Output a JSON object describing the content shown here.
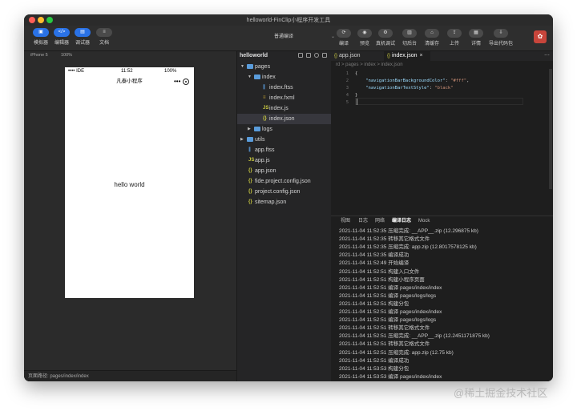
{
  "window": {
    "title": "helloworld-FinClip小程序开发工具"
  },
  "toolbar": {
    "left_buttons": [
      {
        "icon": "phone-icon",
        "label": "模拟器",
        "glyph": "▣",
        "active": true
      },
      {
        "icon": "code-icon",
        "label": "编辑器",
        "glyph": "</>",
        "active": true
      },
      {
        "icon": "debug-icon",
        "label": "调试器",
        "glyph": "▤",
        "active": true
      },
      {
        "icon": "doc-icon",
        "label": "文档",
        "glyph": "≡",
        "active": false
      }
    ],
    "compile_mode": "普通编译",
    "right_buttons": [
      {
        "icon": "compile-icon",
        "label": "编译",
        "glyph": "⟳"
      },
      {
        "icon": "preview-icon",
        "label": "预览",
        "glyph": "◉"
      },
      {
        "icon": "remote-debug-icon",
        "label": "真机调试",
        "glyph": "⚙"
      },
      {
        "icon": "background-icon",
        "label": "切后台",
        "glyph": "▥"
      },
      {
        "icon": "clear-cache-icon",
        "label": "清缓存",
        "glyph": "⌂"
      },
      {
        "icon": "upload-icon",
        "label": "上传",
        "glyph": "⇪"
      },
      {
        "icon": "details-icon",
        "label": "详情",
        "glyph": "▦"
      },
      {
        "icon": "export-icon",
        "label": "导出代码包",
        "glyph": "⇩"
      }
    ],
    "avatar_glyph": "✿"
  },
  "simulator": {
    "device": "iPhone 5",
    "zoom": "100%",
    "status_carrier": "•••• IDE",
    "status_time": "11:52",
    "status_battery": "100%",
    "nav_title": "凡泰小程序",
    "content_text": "hello world",
    "footer_path": "页面路径: pages/index/index"
  },
  "explorer": {
    "title": "helloworld",
    "items": [
      {
        "name": "pages",
        "type": "folder",
        "depth": 0,
        "expanded": true
      },
      {
        "name": "index",
        "type": "folder",
        "depth": 1,
        "expanded": true
      },
      {
        "name": "index.ftss",
        "type": "file",
        "depth": 2,
        "ic": "∥",
        "color": "#5a9cdb"
      },
      {
        "name": "index.fxml",
        "type": "file",
        "depth": 2,
        "ic": "≡",
        "color": "#c5a332"
      },
      {
        "name": "index.js",
        "type": "file",
        "depth": 2,
        "ic": "JS",
        "color": "#cbcb41"
      },
      {
        "name": "index.json",
        "type": "file",
        "depth": 2,
        "ic": "{}",
        "color": "#cbcb41",
        "active": true
      },
      {
        "name": "logs",
        "type": "folder",
        "depth": 1,
        "expanded": false
      },
      {
        "name": "utils",
        "type": "folder",
        "depth": 0,
        "expanded": false
      },
      {
        "name": "app.ftss",
        "type": "file",
        "depth": 0,
        "ic": "∥",
        "color": "#5a9cdb"
      },
      {
        "name": "app.js",
        "type": "file",
        "depth": 0,
        "ic": "JS",
        "color": "#cbcb41"
      },
      {
        "name": "app.json",
        "type": "file",
        "depth": 0,
        "ic": "{}",
        "color": "#cbcb41"
      },
      {
        "name": "fide.project.config.json",
        "type": "file",
        "depth": 0,
        "ic": "{}",
        "color": "#cbcb41"
      },
      {
        "name": "project.config.json",
        "type": "file",
        "depth": 0,
        "ic": "{}",
        "color": "#cbcb41"
      },
      {
        "name": "sitemap.json",
        "type": "file",
        "depth": 0,
        "ic": "{}",
        "color": "#cbcb41"
      }
    ]
  },
  "editor": {
    "tabs": [
      {
        "label": "app.json",
        "active": false
      },
      {
        "label": "index.json",
        "active": true
      }
    ],
    "more": "⋯",
    "breadcrumb": "rd  >  pages  >  index  >  index.json",
    "code_lines": [
      {
        "n": "1",
        "t": "{"
      },
      {
        "n": "2",
        "key": "\"navigationBarBackgroundColor\"",
        "val": "\"#fff\"",
        "tail": ","
      },
      {
        "n": "3",
        "key": "\"navigationBarTextStyle\"",
        "val": "\"black\"",
        "tail": ""
      },
      {
        "n": "4",
        "t": "}"
      },
      {
        "n": "5",
        "t": ""
      }
    ]
  },
  "console": {
    "tabs": [
      "视图",
      "日志",
      "网络",
      "编译日志",
      "Mock"
    ],
    "active_tab": "编译日志",
    "lines": [
      "2021-11-04 11:52:35 压缩完成: __APP__.zip (12.296875 kb)",
      "2021-11-04 11:52:35 转移其它格式文件",
      "2021-11-04 11:52:35 压缩完成: app.zip (12.8017578125 kb)",
      "2021-11-04 11:52:35 编译成功",
      "2021-11-04 11:52:49 开始编译",
      "2021-11-04 11:52:51 构建入口文件",
      "2021-11-04 11:52:51 构建小程序页面",
      "2021-11-04 11:52:51 编译 pages/index/index",
      "2021-11-04 11:52:51 编译 pages/logs/logs",
      "2021-11-04 11:52:51 构建分包",
      "2021-11-04 11:52:51 编译 pages/index/index",
      "2021-11-04 11:52:51 编译 pages/logs/logs",
      "2021-11-04 11:52:51 转移其它格式文件",
      "2021-11-04 11:52:51 压缩完成: __APP__.zip (12.2451171875 kb)",
      "2021-11-04 11:52:51 转移其它格式文件",
      "2021-11-04 11:52:51 压缩完成: app.zip (12.75 kb)",
      "2021-11-04 11:52:51 编译成功",
      "2021-11-04 11:53:53 构建分包",
      "2021-11-04 11:53:53 编译 pages/index/index"
    ]
  },
  "watermark": "@稀土掘金技术社区"
}
